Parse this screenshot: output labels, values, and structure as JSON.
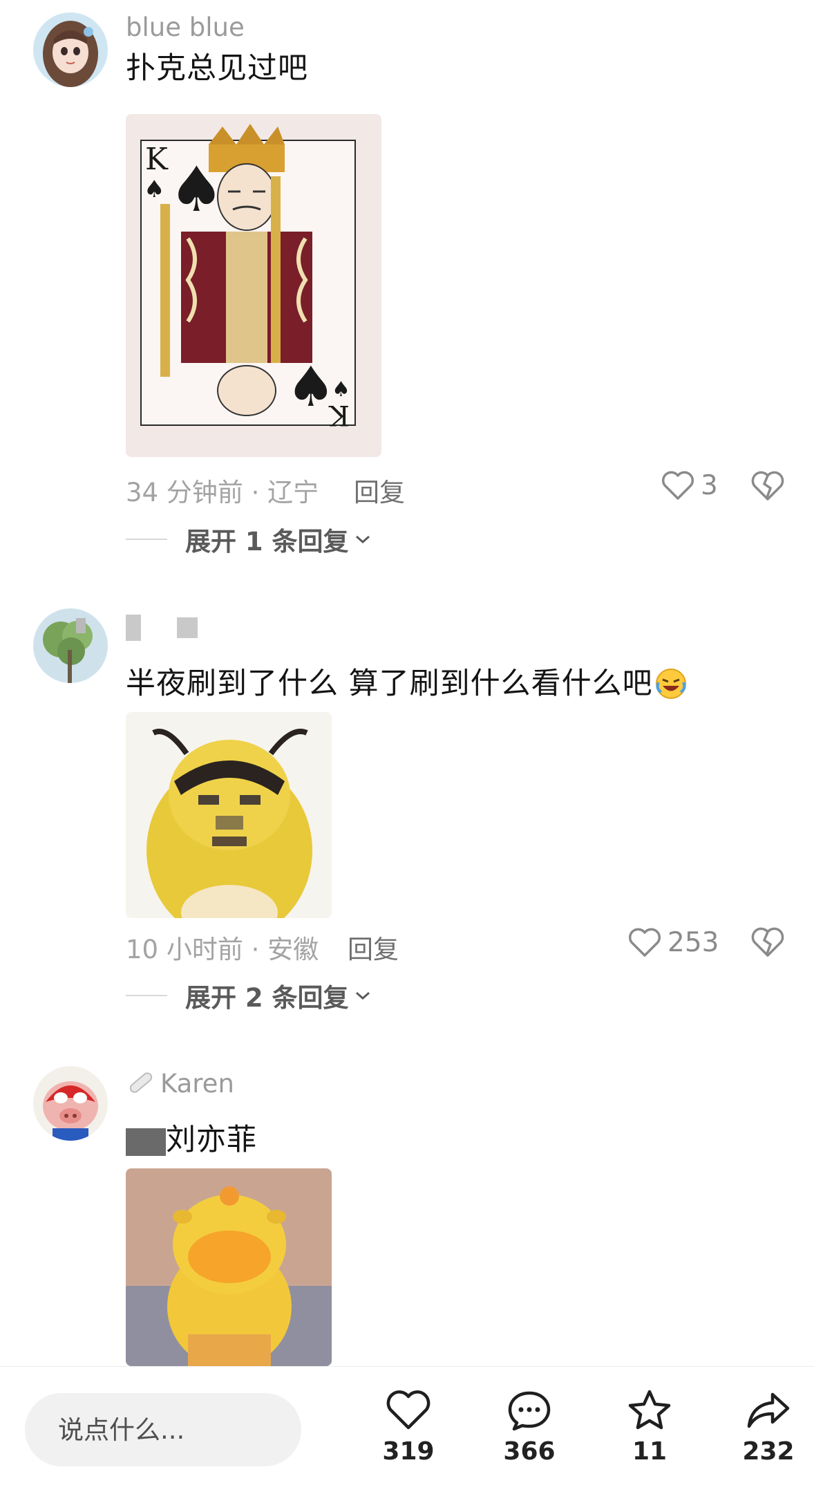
{
  "comments": [
    {
      "username": "blue blue",
      "text": "扑克总见过吧",
      "time_location": "34 分钟前 · 辽宁",
      "reply_label": "回复",
      "likes": "3",
      "expand_label": "展开 1 条回复",
      "image_icon": "king-of-spades-card"
    },
    {
      "username": "",
      "text": "半夜刷到了什么 算了刷到什么看什么吧",
      "time_location": "10 小时前 · 安徽",
      "reply_label": "回复",
      "likes": "253",
      "expand_label": "展开 2 条回复",
      "image_icon": "yellow-character-meme"
    },
    {
      "username": "Karen",
      "text": "刘亦菲",
      "image_icon": "yellow-capybara-meme"
    }
  ],
  "bottom_bar": {
    "input_placeholder": "说点什么...",
    "like_count": "319",
    "comment_count": "366",
    "favorite_count": "11",
    "share_count": "232"
  },
  "colors": {
    "secondary_text": "#9a9a9a",
    "primary_text": "#141414",
    "accent_bg": "#f1f1f1"
  }
}
